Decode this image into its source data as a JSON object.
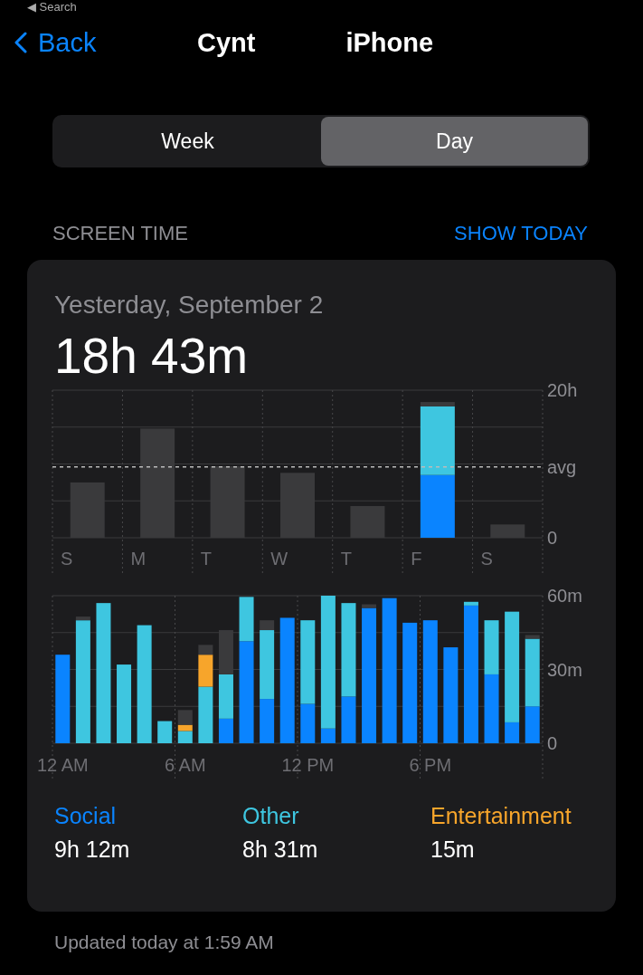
{
  "top_link": "◀ Search",
  "nav": {
    "back": "Back",
    "title_parts": [
      "Cynt",
      "iPhone"
    ]
  },
  "segments": [
    {
      "label": "Week",
      "selected": false
    },
    {
      "label": "Day",
      "selected": true
    }
  ],
  "section": {
    "title": "SCREEN TIME",
    "action": "SHOW TODAY"
  },
  "card": {
    "date": "Yesterday, September 2",
    "total": "18h 43m",
    "week_chart": {
      "chart_data": {
        "type": "bar",
        "stacked": true,
        "categories": [
          "S",
          "M",
          "T",
          "W",
          "T",
          "F",
          "S"
        ],
        "series": [
          {
            "color": "#0a84ff",
            "values": [
              null,
              null,
              null,
              null,
              null,
              8.5,
              null
            ]
          },
          {
            "color": "#3ec6e0",
            "values": [
              null,
              null,
              null,
              null,
              null,
              9.3,
              null
            ]
          },
          {
            "color": "#3a3a3c",
            "values": [
              7.5,
              14.8,
              9.7,
              8.8,
              4.3,
              0.6,
              1.8
            ]
          }
        ],
        "ylim": [
          0,
          20
        ],
        "yticks": [
          0,
          {
            "value": 9.6,
            "label": "avg"
          },
          {
            "value": 20,
            "label": "20h"
          }
        ]
      }
    },
    "hour_chart": {
      "chart_data": {
        "type": "bar",
        "stacked": true,
        "categories": [
          "12 AM",
          null,
          null,
          null,
          null,
          null,
          "6 AM",
          null,
          null,
          null,
          null,
          null,
          "12 PM",
          null,
          null,
          null,
          null,
          null,
          "6 PM",
          null,
          null,
          null,
          null,
          null
        ],
        "series": [
          {
            "name": "Social",
            "color": "#0a84ff",
            "values": [
              36,
              0,
              0,
              0,
              0,
              0,
              0,
              0,
              10,
              41.5,
              18,
              51,
              16,
              6,
              19,
              55,
              59,
              49,
              50,
              39,
              56,
              28,
              8.5,
              15
            ]
          },
          {
            "name": "Other",
            "color": "#3ec6e0",
            "values": [
              0,
              50,
              57,
              32,
              48,
              9,
              5,
              23,
              18,
              18,
              28,
              0,
              34,
              54,
              38,
              0,
              0,
              0,
              0,
              0,
              1.5,
              22,
              45,
              27.5
            ]
          },
          {
            "name": "Entertainment",
            "color": "#f7a52b",
            "values": [
              0,
              0,
              0,
              0,
              0,
              0,
              2.5,
              13,
              0,
              0,
              0,
              0,
              0,
              0,
              0,
              0,
              0,
              0,
              0,
              0,
              0,
              0,
              0,
              0
            ]
          },
          {
            "color": "#3a3a3c",
            "values": [
              0,
              1.5,
              0,
              0,
              0,
              0,
              6,
              4,
              18,
              0,
              4,
              0,
              0,
              0,
              0,
              1.5,
              0,
              0,
              0,
              0,
              0,
              0,
              0,
              1.5
            ]
          }
        ],
        "ylim": [
          0,
          60
        ],
        "yticks": [
          0,
          {
            "value": 30,
            "label": "30m"
          },
          {
            "value": 60,
            "label": "60m"
          }
        ]
      }
    },
    "legend": [
      {
        "value": "9h 12m"
      },
      {
        "value": "8h 31m"
      },
      {
        "value": "15m"
      }
    ]
  },
  "footer": "Updated today at 1:59 AM"
}
